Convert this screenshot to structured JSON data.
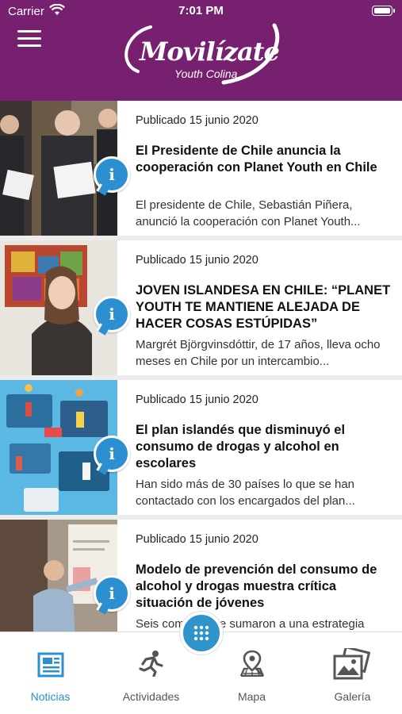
{
  "status_bar": {
    "carrier": "Carrier",
    "time": "7:01 PM"
  },
  "header": {
    "logo_text": "Movilízate",
    "logo_subtext": "Youth Colina",
    "menu_icon": "hamburger-icon",
    "background": "#76206f"
  },
  "news": [
    {
      "date": "Publicado 15 junio 2020",
      "title": "El Presidente de Chile anuncia la cooperación con Planet Youth en Chile",
      "excerpt": "El presidente de Chile, Sebastián Piñera, anunció la cooperación con Planet Youth..."
    },
    {
      "date": "Publicado 15 junio 2020",
      "title": "JOVEN ISLANDESA EN CHILE: “PLANET YOUTH TE MANTIENE ALEJADA DE HACER COSAS ESTÚPIDAS”",
      "excerpt": "Margrét Björgvinsdóttir, de 17 años, lleva ocho meses en Chile por un intercambio..."
    },
    {
      "date": "Publicado 15 junio 2020",
      "title": "El plan islandés que disminuyó el consumo de drogas y alcohol en escolares",
      "excerpt": "Han sido más de 30 países lo que se han contactado con los encargados del plan..."
    },
    {
      "date": "Publicado 15 junio 2020",
      "title": "Modelo de prevención del consumo de alcohol y drogas muestra crítica situación de jóvenes",
      "excerpt": "Seis comunas se sumaron a una estrategia"
    }
  ],
  "tabs": [
    {
      "label": "Noticias",
      "icon": "newspaper-icon",
      "active": true
    },
    {
      "label": "Actividades",
      "icon": "running-person-icon",
      "active": false
    },
    {
      "label": "Mapa",
      "icon": "map-pin-icon",
      "active": false
    },
    {
      "label": "Galería",
      "icon": "photo-gallery-icon",
      "active": false
    }
  ],
  "fab_icon": "grid-dots-icon",
  "accent_color": "#2b8fd0"
}
